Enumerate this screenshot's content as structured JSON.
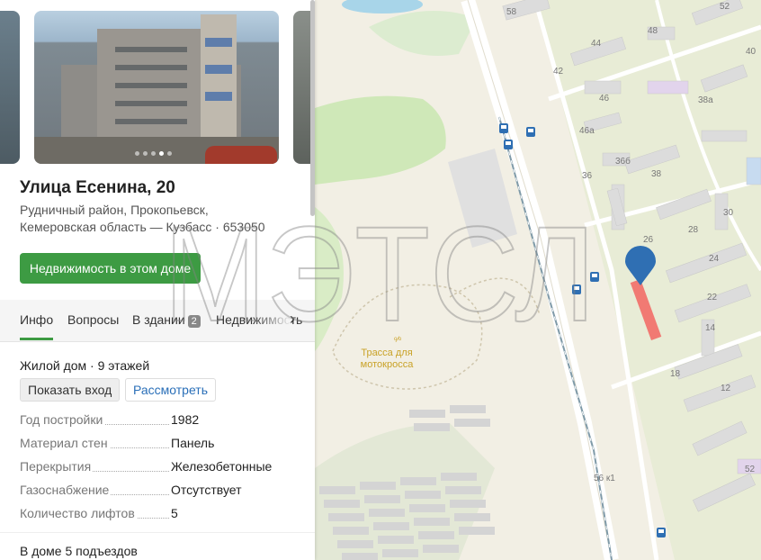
{
  "photos": {
    "count": 5,
    "active_index": 3
  },
  "place": {
    "title": "Улица Есенина, 20",
    "address_line1": "Рудничный район, Прокопьевск,",
    "address_line2": "Кемеровская область — Кузбасс · 653050"
  },
  "buttons": {
    "realty": "Недвижимость в этом доме",
    "show_entrance": "Показать вход",
    "view": "Рассмотреть"
  },
  "tabs": [
    {
      "label": "Инфо"
    },
    {
      "label": "Вопросы"
    },
    {
      "label": "В здании",
      "badge": "2"
    },
    {
      "label": "Недвижимость"
    }
  ],
  "building": {
    "type": "Жилой дом",
    "floors": "9 этажей",
    "properties": [
      {
        "key": "Год постройки",
        "value": "1982"
      },
      {
        "key": "Материал стен",
        "value": "Панель"
      },
      {
        "key": "Перекрытия",
        "value": "Железобетонные"
      },
      {
        "key": "Газоснабжение",
        "value": "Отсутствует"
      },
      {
        "key": "Количество лифтов",
        "value": "5"
      }
    ],
    "entrances": "В доме 5 подъездов"
  },
  "map": {
    "poi_label_line1": "Трасса для",
    "poi_label_line2": "мотокросса",
    "house_numbers": [
      "58",
      "52",
      "48",
      "44",
      "42",
      "46",
      "40",
      "38а",
      "46а",
      "36б",
      "36",
      "38",
      "30",
      "28",
      "26",
      "24",
      "22",
      "14",
      "18",
      "12",
      "56 к1",
      "52"
    ],
    "colors": {
      "land": "#f2efe4",
      "park": "#cfe8b8",
      "block": "#e4ead2",
      "building": "#dcdcdc",
      "rail": "#7f9aa8",
      "marker": "#2f6fb3",
      "highlight": "#f17a73"
    }
  },
  "watermark": "МЭТСЛ"
}
